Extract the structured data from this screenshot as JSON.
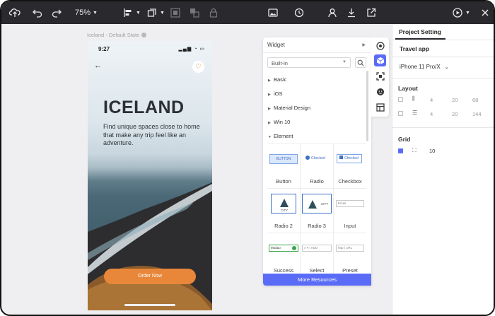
{
  "toolbar": {
    "zoom": "75%",
    "icons": [
      "upload-icon",
      "undo-icon",
      "redo-icon",
      "align-icon",
      "arrange-icon",
      "group-icon",
      "lock-icon",
      "image-icon",
      "history-icon",
      "user-icon",
      "download-icon",
      "share-icon",
      "play-icon"
    ]
  },
  "canvas": {
    "state_label": "Iceland - Default State"
  },
  "phone": {
    "time": "9:27",
    "title": "ICELAND",
    "subtitle": "Find unique spaces close to home that make any trip feel like an adventure.",
    "button": "Order Now",
    "colors": {
      "accent": "#e8873a",
      "sea": "#4a6876"
    }
  },
  "widget_panel": {
    "header": "Widget",
    "source": "Built-in",
    "categories": [
      "Basic",
      "iOS",
      "Material Design",
      "Win 10",
      "Element"
    ],
    "previews": {
      "button": "BUTTON",
      "radio": "Checked",
      "checkbox": "Checked",
      "card_text": "CITY",
      "input_placeholder": "Email",
      "success_value": "Modao",
      "select_value": "A",
      "select_value2": "ADD",
      "preset_prefix": "http",
      "preset_value": "URL"
    },
    "tiles": [
      "Button",
      "Radio",
      "Checkbox",
      "Radio 2",
      "Radio 3",
      "Input",
      "Success",
      "Select",
      "Preset"
    ],
    "more": "More Resources",
    "accent": "#5a6cf7"
  },
  "settings": {
    "tab": "Project Setting",
    "app_name": "Travel app",
    "device": "iPhone 11 Pro/X",
    "layout_label": "Layout",
    "layout_rows": [
      {
        "values": [
          "4",
          "20",
          "68"
        ]
      },
      {
        "values": [
          "4",
          "20",
          "144"
        ]
      }
    ],
    "grid_label": "Grid",
    "grid_value": "10"
  }
}
